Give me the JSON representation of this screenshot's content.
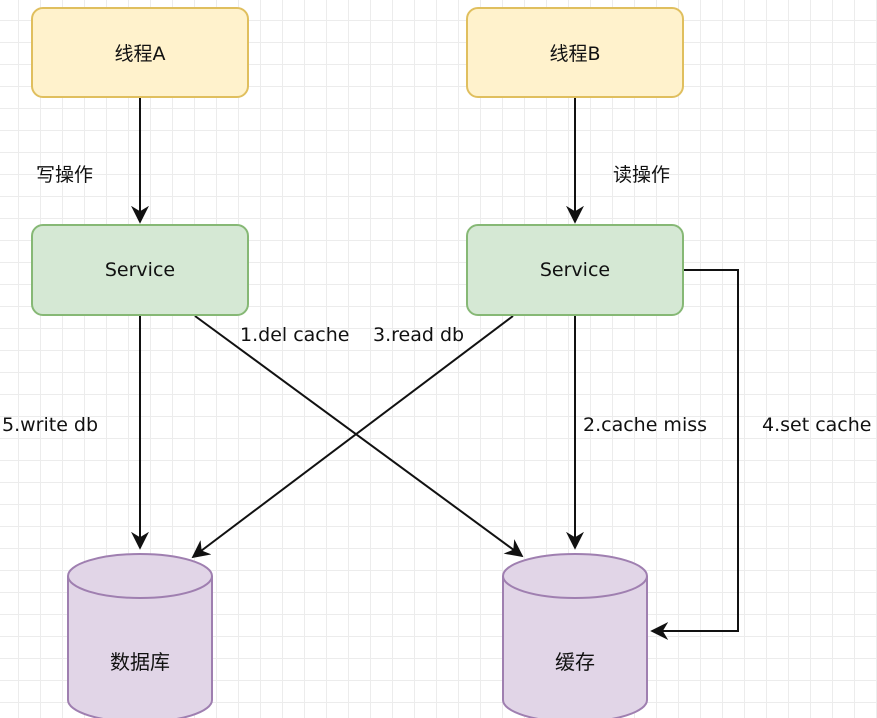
{
  "nodes": {
    "thread_a": "线程A",
    "thread_b": "线程B",
    "service_a": "Service",
    "service_b": "Service",
    "database": "数据库",
    "cache": "缓存"
  },
  "edge_labels": {
    "write_op": "写操作",
    "read_op": "读操作",
    "del_cache": "1.del cache",
    "read_db": "3.read db",
    "write_db": "5.write db",
    "cache_miss": "2.cache miss",
    "set_cache": "4.set cache"
  },
  "colors": {
    "thread_fill": "#fff2cc",
    "thread_border": "#e0bf5e",
    "service_fill": "#d5e8d4",
    "service_border": "#86b875",
    "storage_fill": "#e1d5e7",
    "storage_border": "#9f7fb0",
    "edge": "#111111"
  }
}
